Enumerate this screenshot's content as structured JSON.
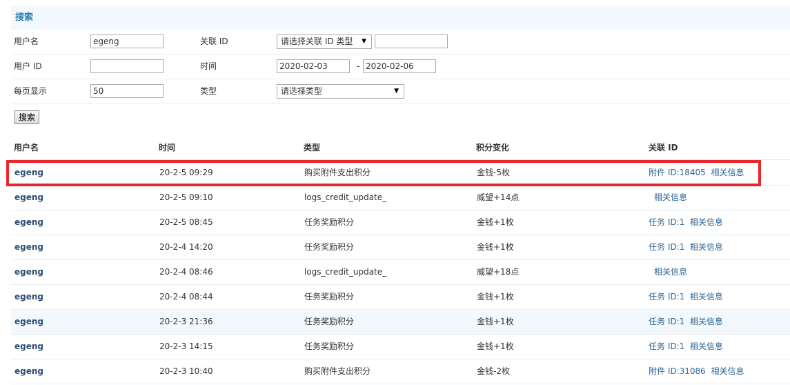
{
  "search": {
    "title": "搜索",
    "username_label": "用户名",
    "username_value": "egeng",
    "relid_label": "关联 ID",
    "relid_type_selected": "请选择关联 ID 类型",
    "relid_value": "",
    "userid_label": "用户 ID",
    "userid_value": "",
    "time_label": "时间",
    "date_from": "2020-02-03",
    "date_sep": "-",
    "date_to": "2020-02-06",
    "perpage_label": "每页显示",
    "perpage_value": "50",
    "type_label": "类型",
    "type_selected": "请选择类型",
    "button_label": "搜索"
  },
  "table": {
    "headers": [
      "用户名",
      "时间",
      "类型",
      "积分变化",
      "关联 ID"
    ],
    "rows": [
      {
        "user": "egeng",
        "time": "20-2-5 09:29",
        "type": "购买附件支出积分",
        "change": "金钱-5枚",
        "relid": "附件 ID:18405",
        "info": "相关信息"
      },
      {
        "user": "egeng",
        "time": "20-2-5 09:10",
        "type": "logs_credit_update_",
        "change": "威望+14点",
        "relid": "",
        "info": "相关信息"
      },
      {
        "user": "egeng",
        "time": "20-2-5 08:45",
        "type": "任务奖励积分",
        "change": "金钱+1枚",
        "relid": "任务 ID:1",
        "info": "相关信息"
      },
      {
        "user": "egeng",
        "time": "20-2-4 14:20",
        "type": "任务奖励积分",
        "change": "金钱+1枚",
        "relid": "任务 ID:1",
        "info": "相关信息"
      },
      {
        "user": "egeng",
        "time": "20-2-4 08:46",
        "type": "logs_credit_update_",
        "change": "威望+18点",
        "relid": "",
        "info": "相关信息"
      },
      {
        "user": "egeng",
        "time": "20-2-4 08:44",
        "type": "任务奖励积分",
        "change": "金钱+1枚",
        "relid": "任务 ID:1",
        "info": "相关信息"
      },
      {
        "user": "egeng",
        "time": "20-2-3 21:36",
        "type": "任务奖励积分",
        "change": "金钱+1枚",
        "relid": "任务 ID:1",
        "info": "相关信息"
      },
      {
        "user": "egeng",
        "time": "20-2-3 14:15",
        "type": "任务奖励积分",
        "change": "金钱+1枚",
        "relid": "任务 ID:1",
        "info": "相关信息"
      },
      {
        "user": "egeng",
        "time": "20-2-3 10:40",
        "type": "购买附件支出积分",
        "change": "金钱-2枚",
        "relid": "附件 ID:31086",
        "info": "相关信息"
      }
    ]
  },
  "colors": {
    "header_text": "#2b7fb1",
    "highlight_box": "#e8262b",
    "link": "#2a6496"
  }
}
